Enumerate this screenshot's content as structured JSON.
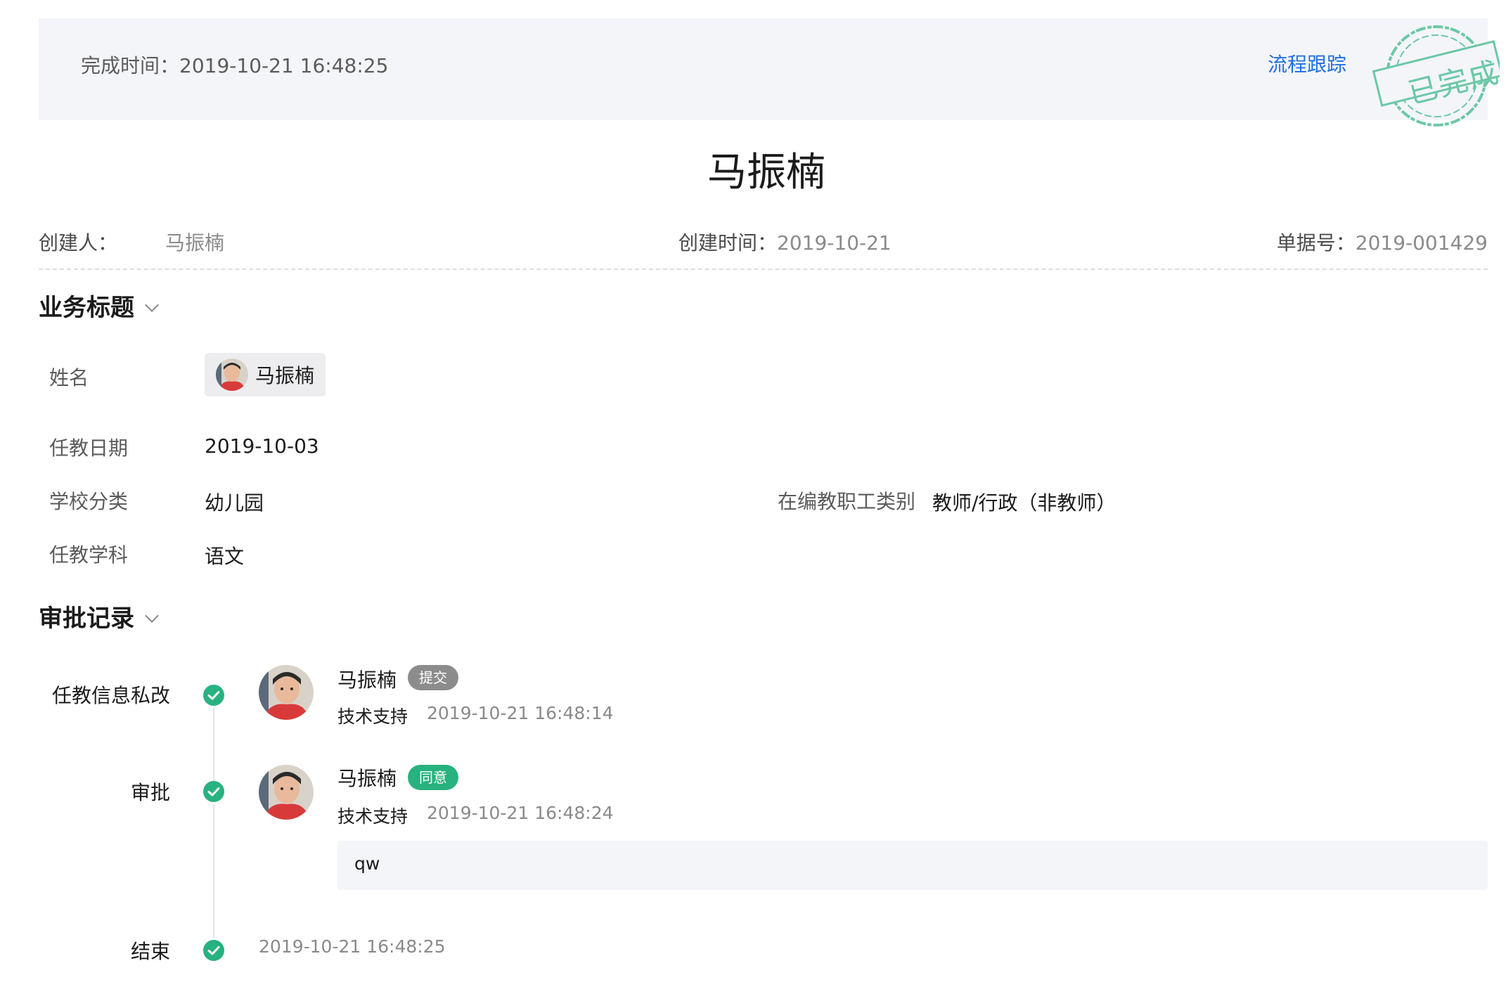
{
  "header": {
    "finish_time_label": "完成时间：",
    "finish_time_value": "2019-10-21 16:48:25",
    "trace_link": "流程跟踪",
    "stamp_text": "已完成"
  },
  "title": "马振楠",
  "meta": {
    "creator_label": "创建人：",
    "creator_value": "马振楠",
    "create_time_label": "创建时间：",
    "create_time_value": "2019-10-21",
    "doc_no_label": "单据号：",
    "doc_no_value": "2019-001429"
  },
  "business": {
    "section_title": "业务标题",
    "fields": {
      "name_label": "姓名",
      "name_value": "马振楠",
      "teach_date_label": "任教日期",
      "teach_date_value": "2019-10-03",
      "school_type_label": "学校分类",
      "school_type_value": "幼儿园",
      "staff_type_label": "在编教职工类别",
      "staff_type_value": "教师/行政（非教师）",
      "subject_label": "任教学科",
      "subject_value": "语文"
    }
  },
  "approval": {
    "section_title": "审批记录",
    "records": [
      {
        "node": "任教信息私改",
        "name": "马振楠",
        "badge": "提交",
        "dept": "技术支持",
        "time": "2019-10-21 16:48:14"
      },
      {
        "node": "审批",
        "name": "马振楠",
        "badge": "同意",
        "dept": "技术支持",
        "time": "2019-10-21 16:48:24",
        "comment": "qw"
      }
    ],
    "end": {
      "node": "结束",
      "time": "2019-10-21 16:48:25"
    }
  },
  "colors": {
    "accent_blue": "#1f6fe0",
    "success_green": "#28b27f",
    "badge_gray": "#8c8c8c",
    "stamp_green": "#6cc8a7"
  }
}
